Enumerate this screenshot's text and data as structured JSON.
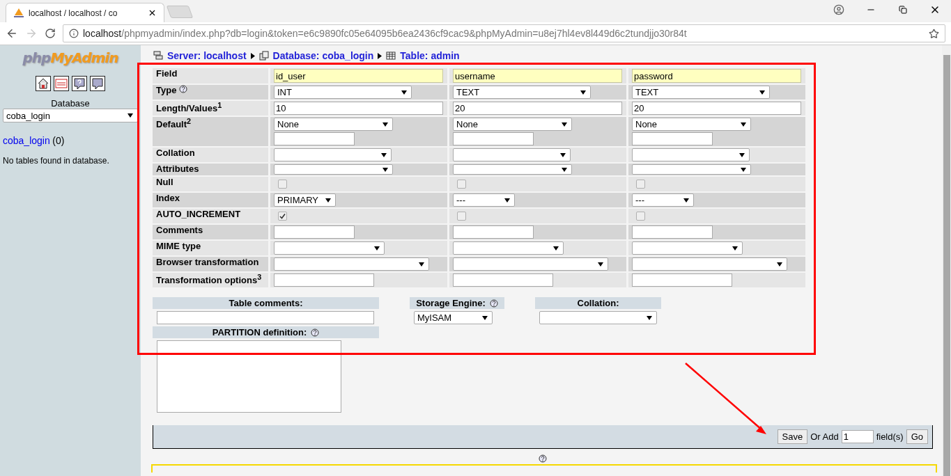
{
  "browser": {
    "tab_title": "localhost / localhost / co",
    "url_host": "localhost",
    "url_path": "/phpmyadmin/index.php?db=login&token=e6c9890fc05e64095b6ea2436cf9cac9&phpMyAdmin=u8ej7hl4ev8l449d6c2tundjjo30r84t",
    "forward_disabled": true
  },
  "sidebar": {
    "logo": [
      "php",
      "MyAdmin"
    ],
    "database_label": "Database",
    "database": "coba_login",
    "db_link": "coba_login",
    "db_count": "(0)",
    "message": "No tables found in database."
  },
  "breadcrumb": [
    {
      "kind": "server",
      "label": "Server: localhost"
    },
    {
      "kind": "database",
      "label": "Database: coba_login"
    },
    {
      "kind": "table",
      "label": "Table: admin"
    }
  ],
  "rows": [
    {
      "kind": "field",
      "label": "Field",
      "help": false
    },
    {
      "kind": "type",
      "label": "Type",
      "help": true
    },
    {
      "kind": "length",
      "label": "Length/Values$^{1}$",
      "help": false
    },
    {
      "kind": "default",
      "label": "Default$^{2}$",
      "help": false
    },
    {
      "kind": "collation",
      "label": "Collation",
      "help": false
    },
    {
      "kind": "attributes",
      "label": "Attributes",
      "help": false
    },
    {
      "kind": "null",
      "label": "Null",
      "help": false
    },
    {
      "kind": "index",
      "label": "Index",
      "help": false
    },
    {
      "kind": "auto_increment",
      "label": "AUTO_INCREMENT",
      "help": false
    },
    {
      "kind": "comments",
      "label": "Comments",
      "help": false
    },
    {
      "kind": "mime",
      "label": "MIME type",
      "help": false
    },
    {
      "kind": "transformation",
      "label": "Browser transformation",
      "help": false
    },
    {
      "kind": "options",
      "label": "Transformation options$^{3}$",
      "help": false
    }
  ],
  "columns": [
    {
      "field": "id_user",
      "type": "INT",
      "length": "10",
      "default": "None",
      "null": false,
      "index": "PRIMARY",
      "auto_increment": true
    },
    {
      "field": "username",
      "type": "TEXT",
      "length": "20",
      "default": "None",
      "null": false,
      "index": "---",
      "auto_increment": false
    },
    {
      "field": "password",
      "type": "TEXT",
      "length": "20",
      "default": "None",
      "null": false,
      "index": "---",
      "auto_increment": false
    }
  ],
  "table_options": {
    "comments_label": "Table comments:",
    "storage_engine_label": "Storage Engine:",
    "storage_engine": "MyISAM",
    "collation_label": "Collation:",
    "partition_label": "PARTITION definition:"
  },
  "footer": {
    "save": "Save",
    "or_add": "Or Add",
    "add_count": "1",
    "fields": "field(s)",
    "go": "Go"
  }
}
